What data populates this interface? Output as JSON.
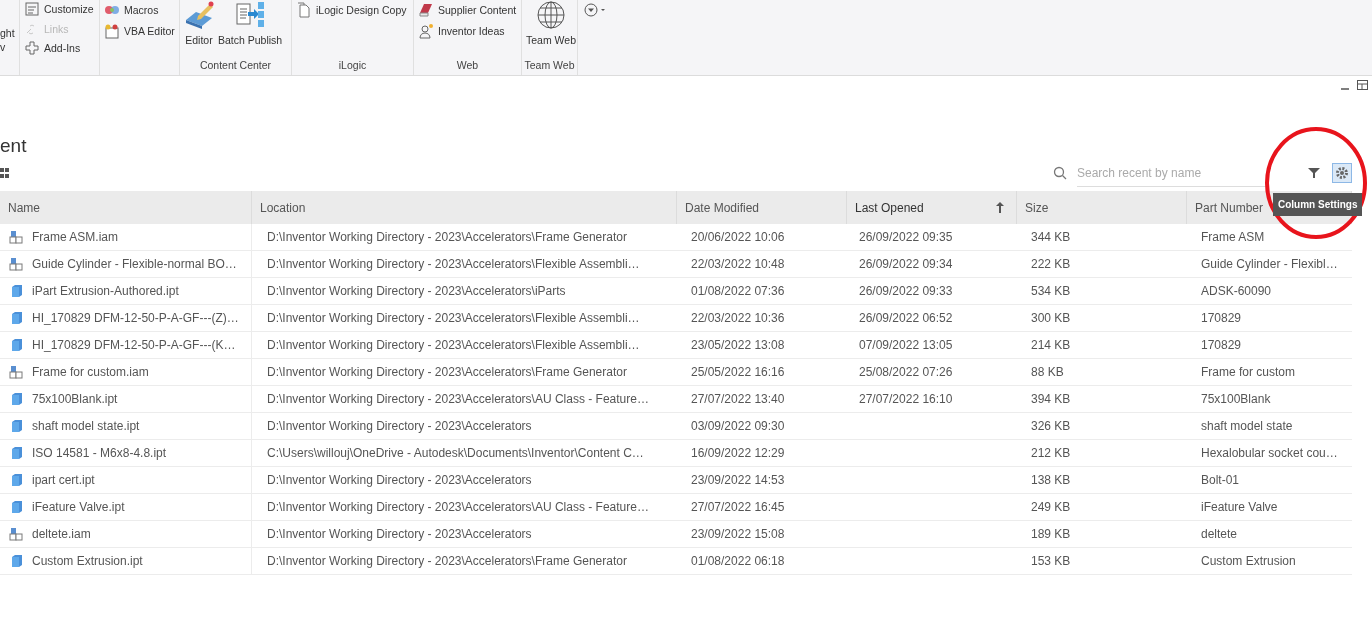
{
  "ribbon": {
    "panels": [
      {
        "items": [
          {
            "kind": "large-partial",
            "lines": [
              "ght",
              "v"
            ]
          }
        ]
      },
      {
        "items": [
          {
            "kind": "small",
            "label": "Customize",
            "disabled": false
          },
          {
            "kind": "small",
            "label": "Links",
            "disabled": true
          },
          {
            "kind": "small",
            "label": "Add-Ins",
            "disabled": false
          }
        ]
      },
      {
        "items": [
          {
            "kind": "small",
            "label": "Macros",
            "disabled": false
          },
          {
            "kind": "small",
            "label": "VBA Editor",
            "disabled": false
          }
        ]
      },
      {
        "label": "Content Center",
        "items": [
          {
            "kind": "large",
            "label": "Editor"
          },
          {
            "kind": "large",
            "label": "Batch Publish"
          }
        ]
      },
      {
        "label": "iLogic",
        "items": [
          {
            "kind": "small",
            "label": "iLogic Design Copy",
            "disabled": false
          }
        ]
      },
      {
        "label": "Web",
        "items": [
          {
            "kind": "small",
            "label": "Supplier Content",
            "disabled": false
          },
          {
            "kind": "small",
            "label": "Inventor Ideas",
            "disabled": false
          }
        ]
      },
      {
        "label": "Team Web",
        "items": [
          {
            "kind": "large",
            "label": "Team Web"
          }
        ]
      }
    ]
  },
  "page_title": "ent",
  "search": {
    "placeholder": "Search recent by name"
  },
  "tooltip": "Column Settings",
  "table": {
    "columns": [
      {
        "label": "Name",
        "sorted": false
      },
      {
        "label": "Location",
        "sorted": false
      },
      {
        "label": "Date Modified",
        "sorted": false
      },
      {
        "label": "Last Opened",
        "sorted": true
      },
      {
        "label": "Size",
        "sorted": false
      },
      {
        "label": "Part Number",
        "sorted": false
      }
    ],
    "rows": [
      {
        "kind": "assembly",
        "cells": [
          "Frame ASM.iam",
          "D:\\Inventor Working Directory - 2023\\Accelerators\\Frame Generator",
          "20/06/2022 10:06",
          "26/09/2022 09:35",
          "344 KB",
          "Frame ASM"
        ]
      },
      {
        "kind": "assembly",
        "cells": [
          "Guide Cylinder - Flexible-normal BO…",
          "D:\\Inventor Working Directory - 2023\\Accelerators\\Flexible Assembli…",
          "22/03/2022 10:48",
          "26/09/2022 09:34",
          "222 KB",
          "Guide Cylinder - Flexibl…"
        ]
      },
      {
        "kind": "part",
        "cells": [
          "iPart Extrusion-Authored.ipt",
          "D:\\Inventor Working Directory - 2023\\Accelerators\\iParts",
          "01/08/2022 07:36",
          "26/09/2022 09:33",
          "534 KB",
          "ADSK-60090"
        ]
      },
      {
        "kind": "part",
        "cells": [
          "HI_170829 DFM-12-50-P-A-GF---(Z)…",
          "D:\\Inventor Working Directory - 2023\\Accelerators\\Flexible Assembli…",
          "22/03/2022 10:36",
          "26/09/2022 06:52",
          "300 KB",
          "170829"
        ]
      },
      {
        "kind": "part",
        "cells": [
          "HI_170829 DFM-12-50-P-A-GF---(K…",
          "D:\\Inventor Working Directory - 2023\\Accelerators\\Flexible Assembli…",
          "23/05/2022 13:08",
          "07/09/2022 13:05",
          "214 KB",
          "170829"
        ]
      },
      {
        "kind": "assembly",
        "cells": [
          "Frame for custom.iam",
          "D:\\Inventor Working Directory - 2023\\Accelerators\\Frame Generator",
          "25/05/2022 16:16",
          "25/08/2022 07:26",
          "88 KB",
          "Frame for custom"
        ]
      },
      {
        "kind": "part",
        "cells": [
          "75x100Blank.ipt",
          "D:\\Inventor Working Directory - 2023\\Accelerators\\AU Class - Feature…",
          "27/07/2022 13:40",
          "27/07/2022 16:10",
          "394 KB",
          "75x100Blank"
        ]
      },
      {
        "kind": "part",
        "cells": [
          "shaft model state.ipt",
          "D:\\Inventor Working Directory - 2023\\Accelerators",
          "03/09/2022 09:30",
          "",
          "326 KB",
          "shaft model state"
        ]
      },
      {
        "kind": "part",
        "cells": [
          "ISO 14581 - M6x8-4.8.ipt",
          "C:\\Users\\willouj\\OneDrive - Autodesk\\Documents\\Inventor\\Content C…",
          "16/09/2022 12:29",
          "",
          "212 KB",
          "Hexalobular socket cou…"
        ]
      },
      {
        "kind": "part",
        "cells": [
          "ipart cert.ipt",
          "D:\\Inventor Working Directory - 2023\\Accelerators",
          "23/09/2022 14:53",
          "",
          "138 KB",
          "Bolt-01"
        ]
      },
      {
        "kind": "part",
        "cells": [
          "iFeature Valve.ipt",
          "D:\\Inventor Working Directory - 2023\\Accelerators\\AU Class - Feature…",
          "27/07/2022 16:45",
          "",
          "249 KB",
          "iFeature Valve"
        ]
      },
      {
        "kind": "assembly",
        "cells": [
          "deltete.iam",
          "D:\\Inventor Working Directory - 2023\\Accelerators",
          "23/09/2022 15:08",
          "",
          "189 KB",
          "deltete"
        ]
      },
      {
        "kind": "part",
        "cells": [
          "Custom Extrusion.ipt",
          "D:\\Inventor Working Directory - 2023\\Accelerators\\Frame Generator",
          "01/08/2022 06:18",
          "",
          "153 KB",
          "Custom Extrusion"
        ]
      }
    ]
  }
}
